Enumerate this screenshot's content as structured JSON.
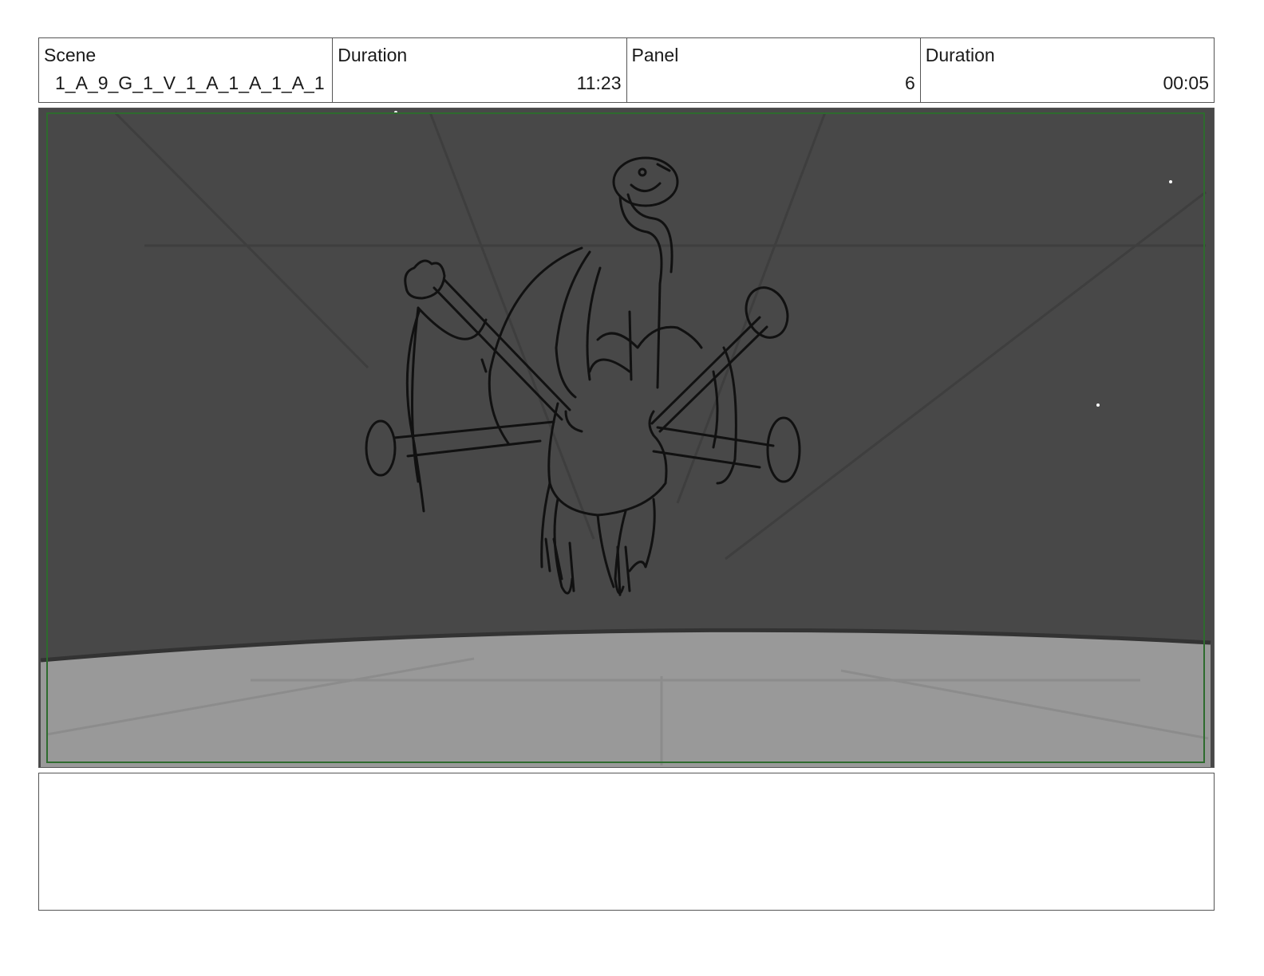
{
  "header": {
    "scene_label": "Scene",
    "scene_value": "1_A_9_G_1_V_1_A_1_A_1_A_1",
    "scene_duration_label": "Duration",
    "scene_duration_value": "11:23",
    "panel_label": "Panel",
    "panel_value": "6",
    "panel_duration_label": "Duration",
    "panel_duration_value": "00:05"
  },
  "frame": {
    "sky_color": "#484848",
    "ground_color": "#999999",
    "safe_area_color": "#2e6b2e",
    "sketch_color": "#111111"
  },
  "notes": {
    "text": ""
  }
}
